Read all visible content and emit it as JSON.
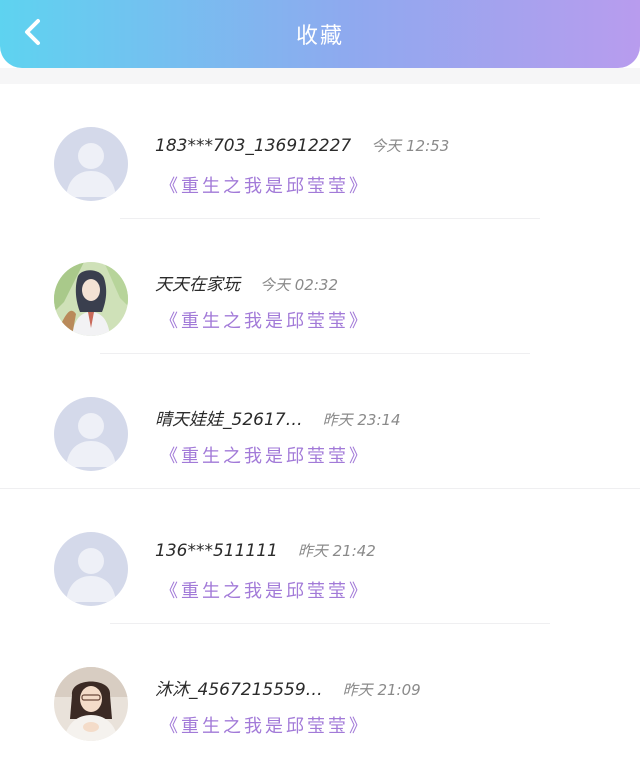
{
  "header": {
    "title": "收藏",
    "back_icon": "chevron-left-icon"
  },
  "colors": {
    "header_gradient_start": "#5ed3f0",
    "header_gradient_end": "#b89cee",
    "book_title": "#a27ad8"
  },
  "items": [
    {
      "name": "183***703_136912227",
      "time": "今天 12:53",
      "book": "《重生之我是邱莹莹》",
      "avatar": "default-avatar"
    },
    {
      "name": "天天在家玩",
      "time": "今天 02:32",
      "book": "《重生之我是邱莹莹》",
      "avatar": "anime-photo-avatar"
    },
    {
      "name": "晴天娃娃_52617…",
      "time": "昨天 23:14",
      "book": "《重生之我是邱莹莹》",
      "avatar": "default-avatar"
    },
    {
      "name": "136***511111",
      "time": "昨天 21:42",
      "book": "《重生之我是邱莹莹》",
      "avatar": "default-avatar"
    },
    {
      "name": "沐沐_4567215559…",
      "time": "昨天 21:09",
      "book": "《重生之我是邱莹莹》",
      "avatar": "woman-photo-avatar"
    }
  ]
}
